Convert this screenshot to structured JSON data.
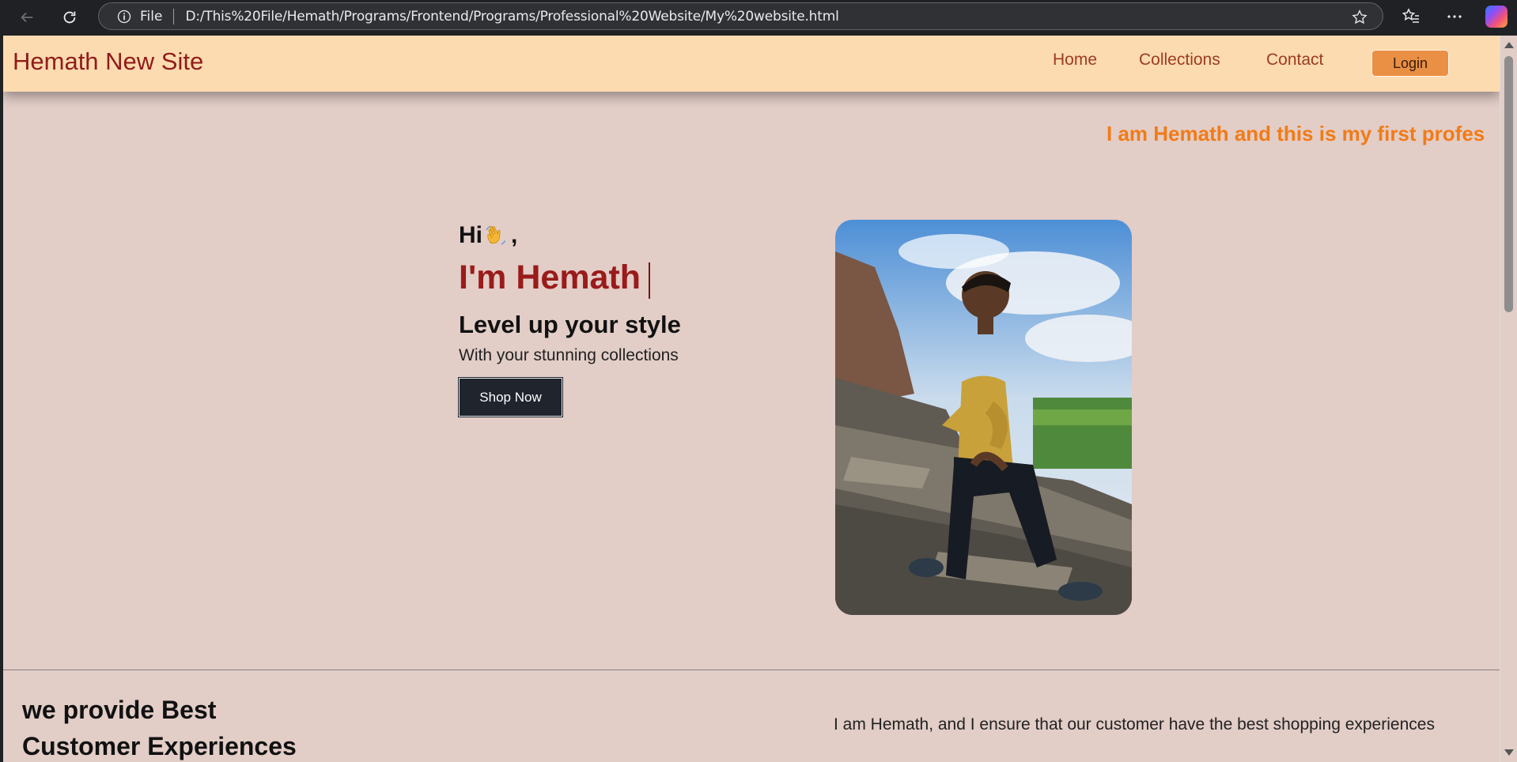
{
  "browser": {
    "file_label": "File",
    "url": "D:/This%20File/Hemath/Programs/Frontend/Programs/Professional%20Website/My%20website.html"
  },
  "site": {
    "brand": "Hemath New Site",
    "nav": [
      {
        "label": "Home"
      },
      {
        "label": "Collections"
      },
      {
        "label": "Contact"
      }
    ],
    "login_label": "Login",
    "marquee_text": "I am Hemath and this is my first profes"
  },
  "hero": {
    "greeting_prefix": "Hi",
    "greeting_suffix": ",",
    "name": "I'm Hemath",
    "tagline": "Level up your style",
    "subtagline": "With your stunning collections",
    "cta_label": "Shop Now"
  },
  "about": {
    "title_line1": "we provide Best",
    "title_line2": "Customer Experiences",
    "text": "I am Hemath, and I ensure that our customer have the best shopping experiences"
  },
  "colors": {
    "page_bg": "#e2cdc7",
    "header_bg": "#fddbb0",
    "brand": "#8f1c1a",
    "accent": "#f27b16",
    "login_bg": "#e99044",
    "cta_bg": "#1f242d"
  }
}
